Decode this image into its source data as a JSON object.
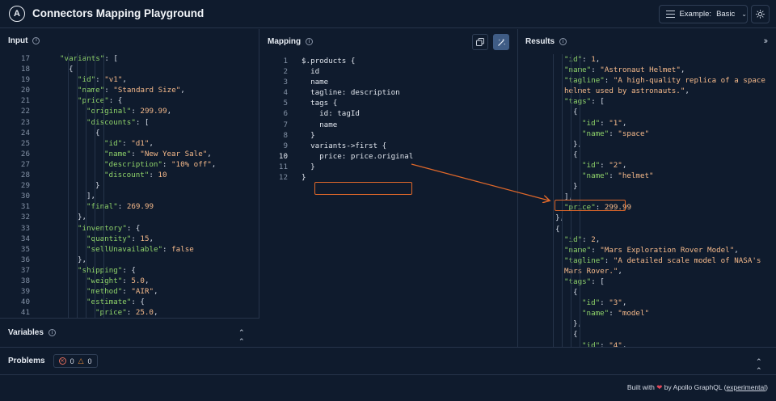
{
  "header": {
    "title": "Connectors Mapping Playground",
    "logo_letter": "A",
    "example_label": "Example:",
    "example_value": "Basic"
  },
  "input": {
    "title": "Input",
    "lines": [
      {
        "n": "17",
        "html": "<span class='key'>\"variants\"</span><span class='punc'>: [</span>",
        "indent": 2
      },
      {
        "n": "18",
        "html": "<span class='punc'>{</span>",
        "indent": 3
      },
      {
        "n": "19",
        "html": "<span class='key'>\"id\"</span><span class='punc'>: </span><span class='str'>\"v1\"</span><span class='punc'>,</span>",
        "indent": 4
      },
      {
        "n": "20",
        "html": "<span class='key'>\"name\"</span><span class='punc'>: </span><span class='str'>\"Standard Size\"</span><span class='punc'>,</span>",
        "indent": 4
      },
      {
        "n": "21",
        "html": "<span class='key'>\"price\"</span><span class='punc'>: {</span>",
        "indent": 4
      },
      {
        "n": "22",
        "html": "<span class='key'>\"original\"</span><span class='punc'>: </span><span class='numv'>299.99</span><span class='punc'>,</span>",
        "indent": 5
      },
      {
        "n": "23",
        "html": "<span class='key'>\"discounts\"</span><span class='punc'>: [</span>",
        "indent": 5
      },
      {
        "n": "24",
        "html": "<span class='punc'>{</span>",
        "indent": 6
      },
      {
        "n": "25",
        "html": "<span class='key'>\"id\"</span><span class='punc'>: </span><span class='str'>\"d1\"</span><span class='punc'>,</span>",
        "indent": 7
      },
      {
        "n": "26",
        "html": "<span class='key'>\"name\"</span><span class='punc'>: </span><span class='str'>\"New Year Sale\"</span><span class='punc'>,</span>",
        "indent": 7
      },
      {
        "n": "27",
        "html": "<span class='key'>\"description\"</span><span class='punc'>: </span><span class='str'>\"10% off\"</span><span class='punc'>,</span>",
        "indent": 7
      },
      {
        "n": "28",
        "html": "<span class='key'>\"discount\"</span><span class='punc'>: </span><span class='numv'>10</span>",
        "indent": 7
      },
      {
        "n": "29",
        "html": "<span class='punc'>}</span>",
        "indent": 6
      },
      {
        "n": "30",
        "html": "<span class='punc'>],</span>",
        "indent": 5
      },
      {
        "n": "31",
        "html": "<span class='key'>\"final\"</span><span class='punc'>: </span><span class='numv'>269.99</span>",
        "indent": 5
      },
      {
        "n": "32",
        "html": "<span class='punc'>},</span>",
        "indent": 4
      },
      {
        "n": "33",
        "html": "<span class='key'>\"inventory\"</span><span class='punc'>: {</span>",
        "indent": 4
      },
      {
        "n": "34",
        "html": "<span class='key'>\"quantity\"</span><span class='punc'>: </span><span class='numv'>15</span><span class='punc'>,</span>",
        "indent": 5
      },
      {
        "n": "35",
        "html": "<span class='key'>\"sellUnavailable\"</span><span class='punc'>: </span><span class='bool'>false</span>",
        "indent": 5
      },
      {
        "n": "36",
        "html": "<span class='punc'>},</span>",
        "indent": 4
      },
      {
        "n": "37",
        "html": "<span class='key'>\"shipping\"</span><span class='punc'>: {</span>",
        "indent": 4
      },
      {
        "n": "38",
        "html": "<span class='key'>\"weight\"</span><span class='punc'>: </span><span class='numv'>5.0</span><span class='punc'>,</span>",
        "indent": 5
      },
      {
        "n": "39",
        "html": "<span class='key'>\"method\"</span><span class='punc'>: </span><span class='str'>\"AIR\"</span><span class='punc'>,</span>",
        "indent": 5
      },
      {
        "n": "40",
        "html": "<span class='key'>\"estimate\"</span><span class='punc'>: {</span>",
        "indent": 5
      },
      {
        "n": "41",
        "html": "<span class='key'>\"price\"</span><span class='punc'>: </span><span class='numv'>25.0</span><span class='punc'>,</span>",
        "indent": 6
      }
    ]
  },
  "variables": {
    "title": "Variables"
  },
  "mapping": {
    "title": "Mapping",
    "lines": [
      {
        "n": "1",
        "text": "$.products {"
      },
      {
        "n": "2",
        "text": "  id"
      },
      {
        "n": "3",
        "text": "  name"
      },
      {
        "n": "4",
        "text": "  tagline: description"
      },
      {
        "n": "5",
        "text": "  tags {"
      },
      {
        "n": "6",
        "text": "    id: tagId"
      },
      {
        "n": "7",
        "text": "    name"
      },
      {
        "n": "8",
        "text": "  }"
      },
      {
        "n": "9",
        "text": "  variants->first {"
      },
      {
        "n": "10",
        "text": "    price: price.original"
      },
      {
        "n": "11",
        "text": "  }"
      },
      {
        "n": "12",
        "text": "}"
      }
    ]
  },
  "results": {
    "title": "Results",
    "lines": [
      {
        "html": "<span class='key'>\"id\"</span><span class='punc'>: </span><span class='numv'>1</span><span class='punc'>,</span>",
        "indent": 2
      },
      {
        "html": "<span class='key'>\"name\"</span><span class='punc'>: </span><span class='str'>\"Astronaut Helmet\"</span><span class='punc'>,</span>",
        "indent": 2
      },
      {
        "html": "<span class='key'>\"tagline\"</span><span class='punc'>: </span><span class='str'>\"A high-quality replica of a space</span>",
        "indent": 2
      },
      {
        "html": "<span class='str'>helmet used by astronauts.\"</span><span class='punc'>,</span>",
        "indent": 2
      },
      {
        "html": "<span class='key'>\"tags\"</span><span class='punc'>: [</span>",
        "indent": 2
      },
      {
        "html": "<span class='punc'>{</span>",
        "indent": 3
      },
      {
        "html": "<span class='key'>\"id\"</span><span class='punc'>: </span><span class='str'>\"1\"</span><span class='punc'>,</span>",
        "indent": 4
      },
      {
        "html": "<span class='key'>\"name\"</span><span class='punc'>: </span><span class='str'>\"space\"</span>",
        "indent": 4
      },
      {
        "html": "<span class='punc'>},</span>",
        "indent": 3
      },
      {
        "html": "<span class='punc'>{</span>",
        "indent": 3
      },
      {
        "html": "<span class='key'>\"id\"</span><span class='punc'>: </span><span class='str'>\"2\"</span><span class='punc'>,</span>",
        "indent": 4
      },
      {
        "html": "<span class='key'>\"name\"</span><span class='punc'>: </span><span class='str'>\"helmet\"</span>",
        "indent": 4
      },
      {
        "html": "<span class='punc'>}</span>",
        "indent": 3
      },
      {
        "html": "<span class='punc'>],</span>",
        "indent": 2
      },
      {
        "html": "<span class='key'>\"price\"</span><span class='punc'>: </span><span class='numv'>299.99</span>",
        "indent": 2
      },
      {
        "html": "<span class='punc'>},</span>",
        "indent": 1
      },
      {
        "html": "<span class='punc'>{</span>",
        "indent": 1
      },
      {
        "html": "<span class='key'>\"id\"</span><span class='punc'>: </span><span class='numv'>2</span><span class='punc'>,</span>",
        "indent": 2
      },
      {
        "html": "<span class='key'>\"name\"</span><span class='punc'>: </span><span class='str'>\"Mars Exploration Rover Model\"</span><span class='punc'>,</span>",
        "indent": 2
      },
      {
        "html": "<span class='key'>\"tagline\"</span><span class='punc'>: </span><span class='str'>\"A detailed scale model of NASA's</span>",
        "indent": 2
      },
      {
        "html": "<span class='str'>Mars Rover.\"</span><span class='punc'>,</span>",
        "indent": 2
      },
      {
        "html": "<span class='key'>\"tags\"</span><span class='punc'>: [</span>",
        "indent": 2
      },
      {
        "html": "<span class='punc'>{</span>",
        "indent": 3
      },
      {
        "html": "<span class='key'>\"id\"</span><span class='punc'>: </span><span class='str'>\"3\"</span><span class='punc'>,</span>",
        "indent": 4
      },
      {
        "html": "<span class='key'>\"name\"</span><span class='punc'>: </span><span class='str'>\"model\"</span>",
        "indent": 4
      },
      {
        "html": "<span class='punc'>},</span>",
        "indent": 3
      },
      {
        "html": "<span class='punc'>{</span>",
        "indent": 3
      },
      {
        "html": "<span class='key'>\"id\"</span><span class='punc'>: </span><span class='str'>\"4\"</span><span class='punc'>,</span>",
        "indent": 4
      }
    ]
  },
  "problems": {
    "title": "Problems",
    "error_count": "0",
    "warning_count": "0"
  },
  "footer": {
    "prefix": "Built with",
    "middle": "by Apollo GraphQL (",
    "link": "experimental",
    "suffix": ")"
  },
  "colors": {
    "background": "#0f1b2d",
    "accent_highlight": "#e0682a",
    "json_key": "#8fd36a",
    "json_value": "#f5b98a"
  }
}
